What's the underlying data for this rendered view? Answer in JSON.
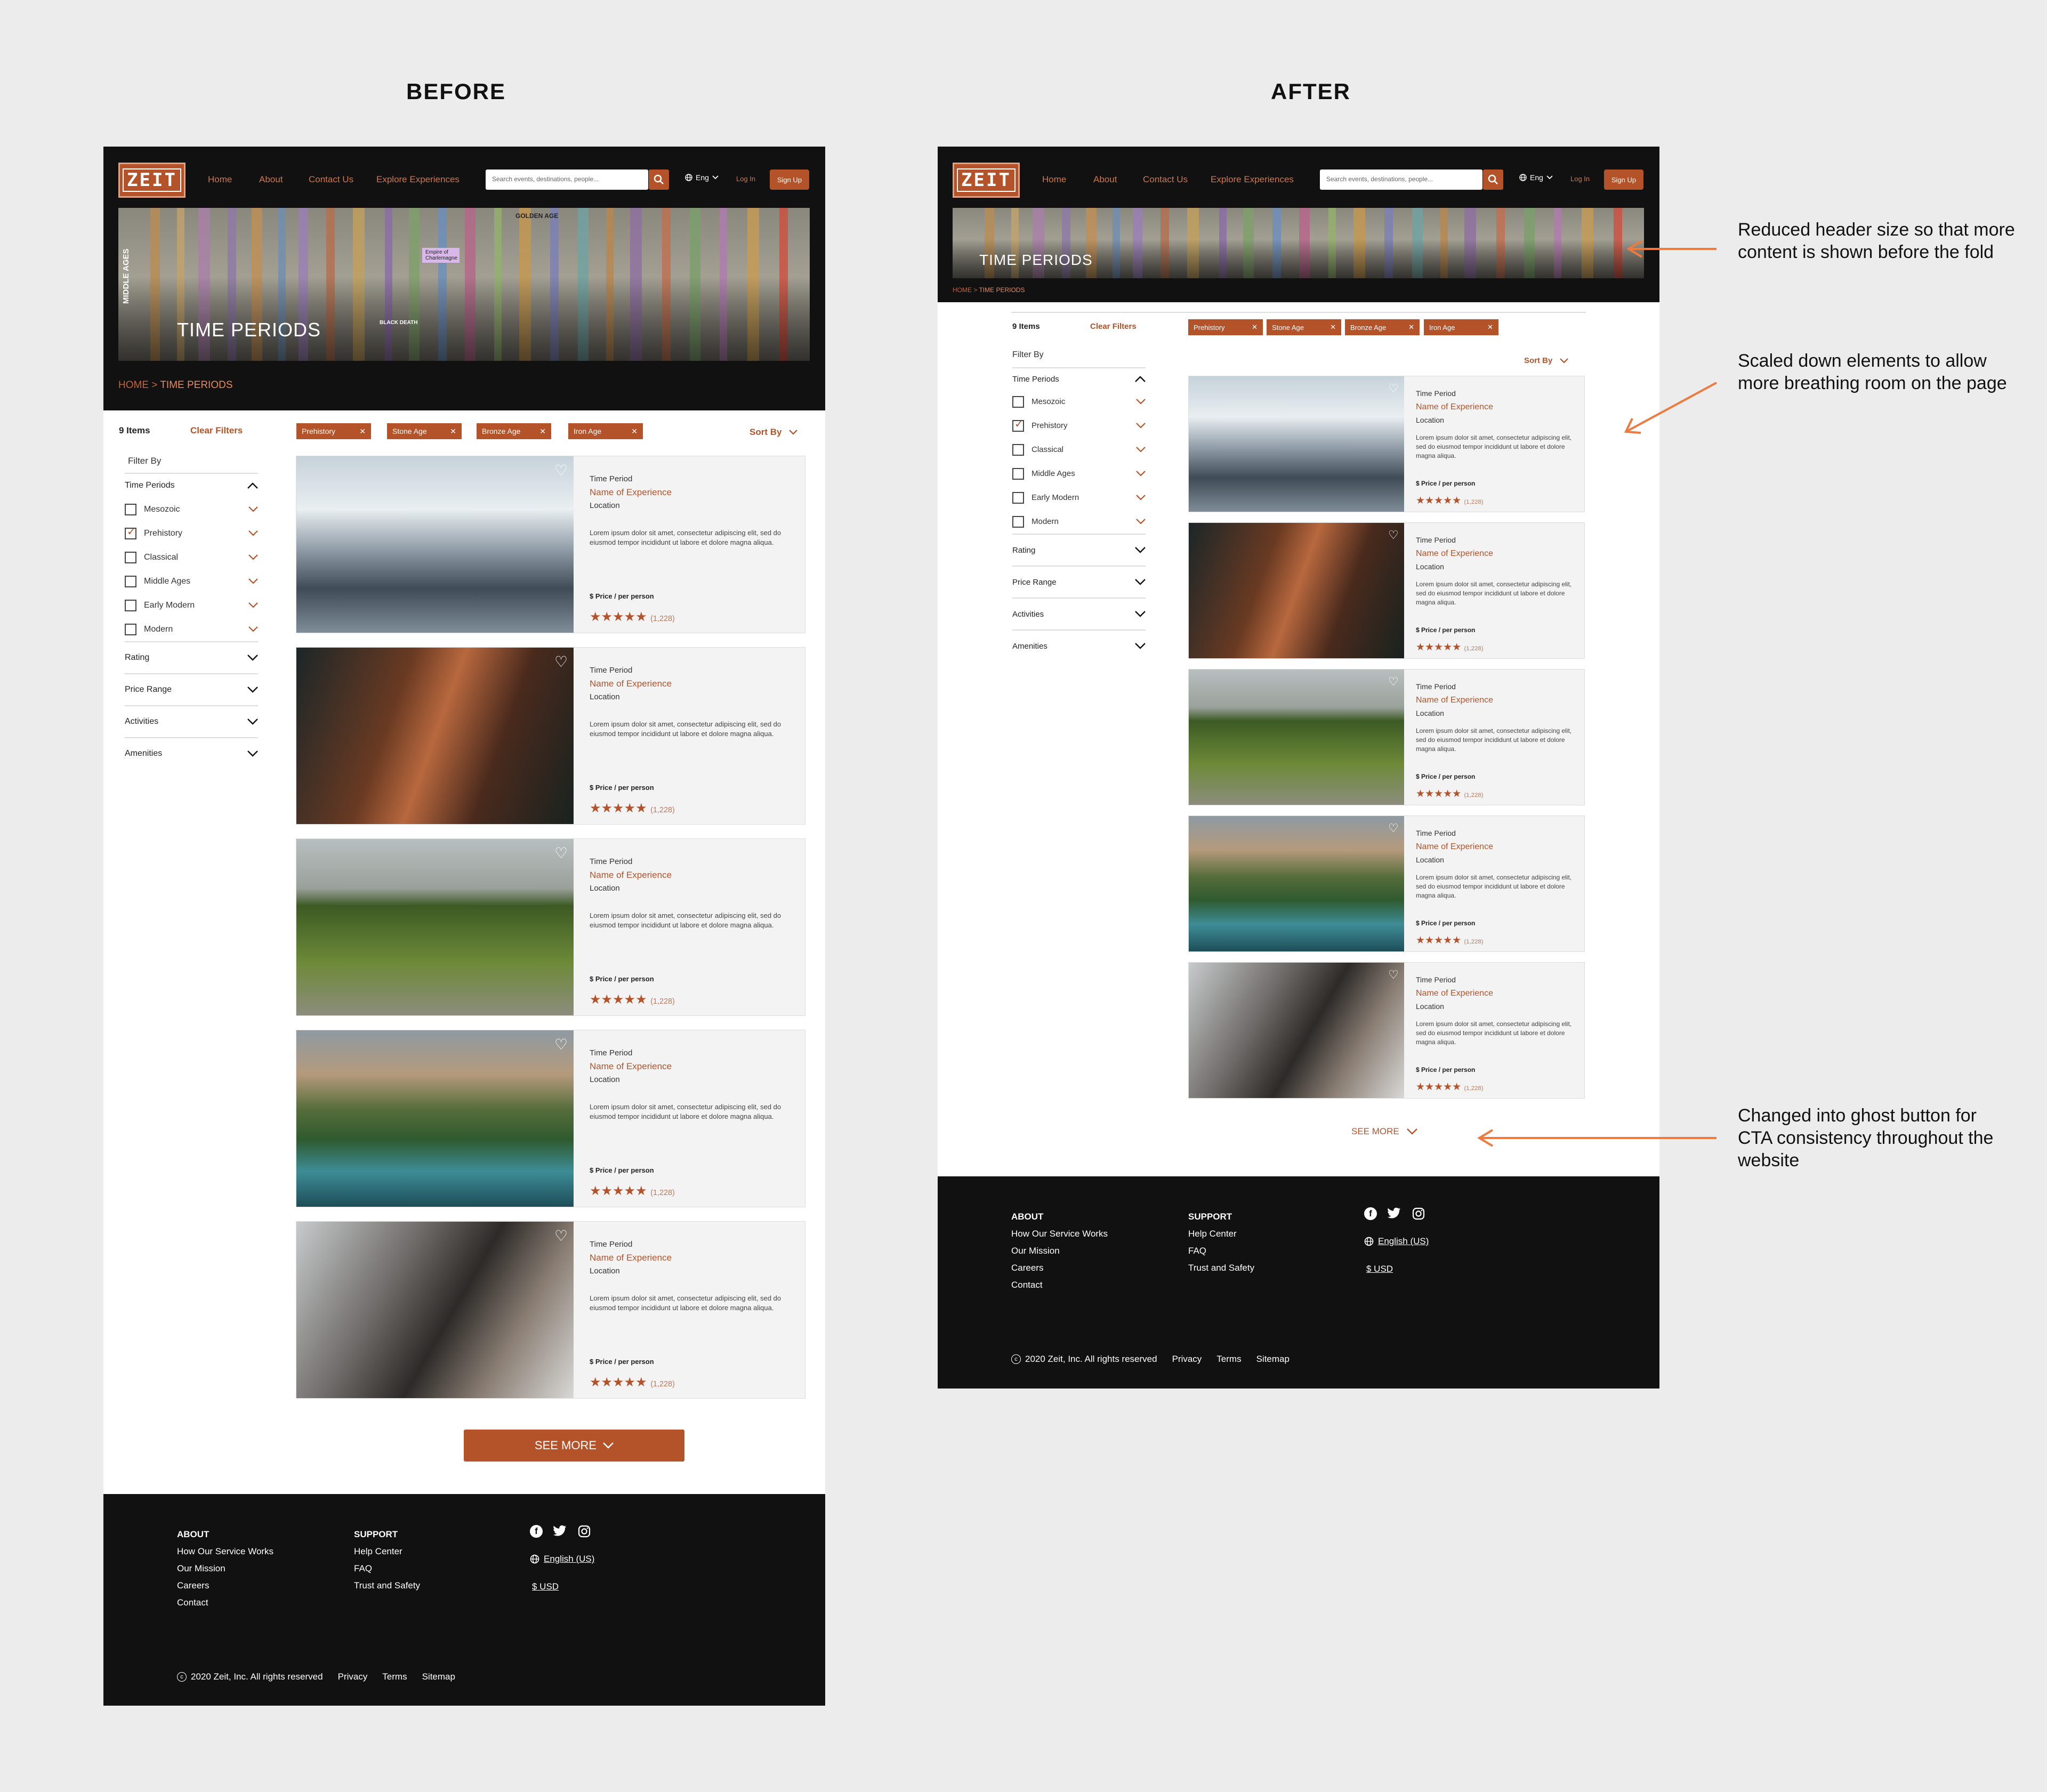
{
  "labels": {
    "before": "BEFORE",
    "after": "AFTER"
  },
  "nav": {
    "logo": "ZEIT",
    "links": [
      "Home",
      "About",
      "Contact Us",
      "Explore Experiences"
    ],
    "search_placeholder": "Search events, destinations, people...",
    "lang": "Eng",
    "login": "Log In",
    "signup": "Sign Up"
  },
  "hero": {
    "title": "TIME PERIODS",
    "hero_text": [
      "MIDDLE AGES",
      "Empire of Charlemagne",
      "GOLDEN AGE",
      "BLACK DEATH"
    ]
  },
  "breadcrumb": {
    "home": "HOME",
    "sep": " > ",
    "current": "TIME PERIODS"
  },
  "filters": {
    "count": "9 Items",
    "clear": "Clear Filters",
    "chips": [
      "Prehistory",
      "Stone Age",
      "Bronze Age",
      "Iron Age"
    ],
    "sort": "Sort By"
  },
  "sidebar": {
    "title": "Filter By",
    "group": "Time Periods",
    "options": [
      {
        "label": "Mesozoic",
        "checked": false
      },
      {
        "label": "Prehistory",
        "checked": true
      },
      {
        "label": "Classical",
        "checked": false
      },
      {
        "label": "Middle Ages",
        "checked": false
      },
      {
        "label": "Early Modern",
        "checked": false
      },
      {
        "label": "Modern",
        "checked": false
      }
    ],
    "sections": [
      "Rating",
      "Price Range",
      "Activities",
      "Amenities"
    ]
  },
  "card": {
    "time_period": "Time Period",
    "name": "Name of Experience",
    "location": "Location",
    "description": "Lorem ipsum dolor sit amet, consectetur adipiscing elit, sed do eiusmod tempor incididunt ut labore et dolore magna aliqua.",
    "price": "$ Price / per person",
    "stars": "★★★★★",
    "reviews": "(1,228)"
  },
  "cards": [
    {
      "image": "snowy-mountains"
    },
    {
      "image": "canyon"
    },
    {
      "image": "grassland-stones"
    },
    {
      "image": "coastal-mountains"
    },
    {
      "image": "dinosaur-skeleton"
    }
  ],
  "see_more": "SEE MORE",
  "footer": {
    "about_head": "ABOUT",
    "about": [
      "How Our Service Works",
      "Our Mission",
      "Careers",
      "Contact"
    ],
    "support_head": "SUPPORT",
    "support": [
      "Help Center",
      "FAQ",
      "Trust and Safety"
    ],
    "language": "English (US)",
    "currency": "$ USD",
    "copyright": "2020 Zeit, Inc. All rights reserved",
    "legal": [
      "Privacy",
      "Terms",
      "Sitemap"
    ],
    "social_icons": [
      "facebook-icon",
      "twitter-icon",
      "instagram-icon"
    ]
  },
  "annotations": [
    "Reduced header size so that more content is shown before the fold",
    "Scaled down elements to allow more breathing room on the page",
    "Changed into ghost button for CTA consistency throughout the website"
  ],
  "colors": {
    "accent": "#b4532a",
    "annotation_arrow": "#ee7a3f",
    "dark": "#111111"
  }
}
